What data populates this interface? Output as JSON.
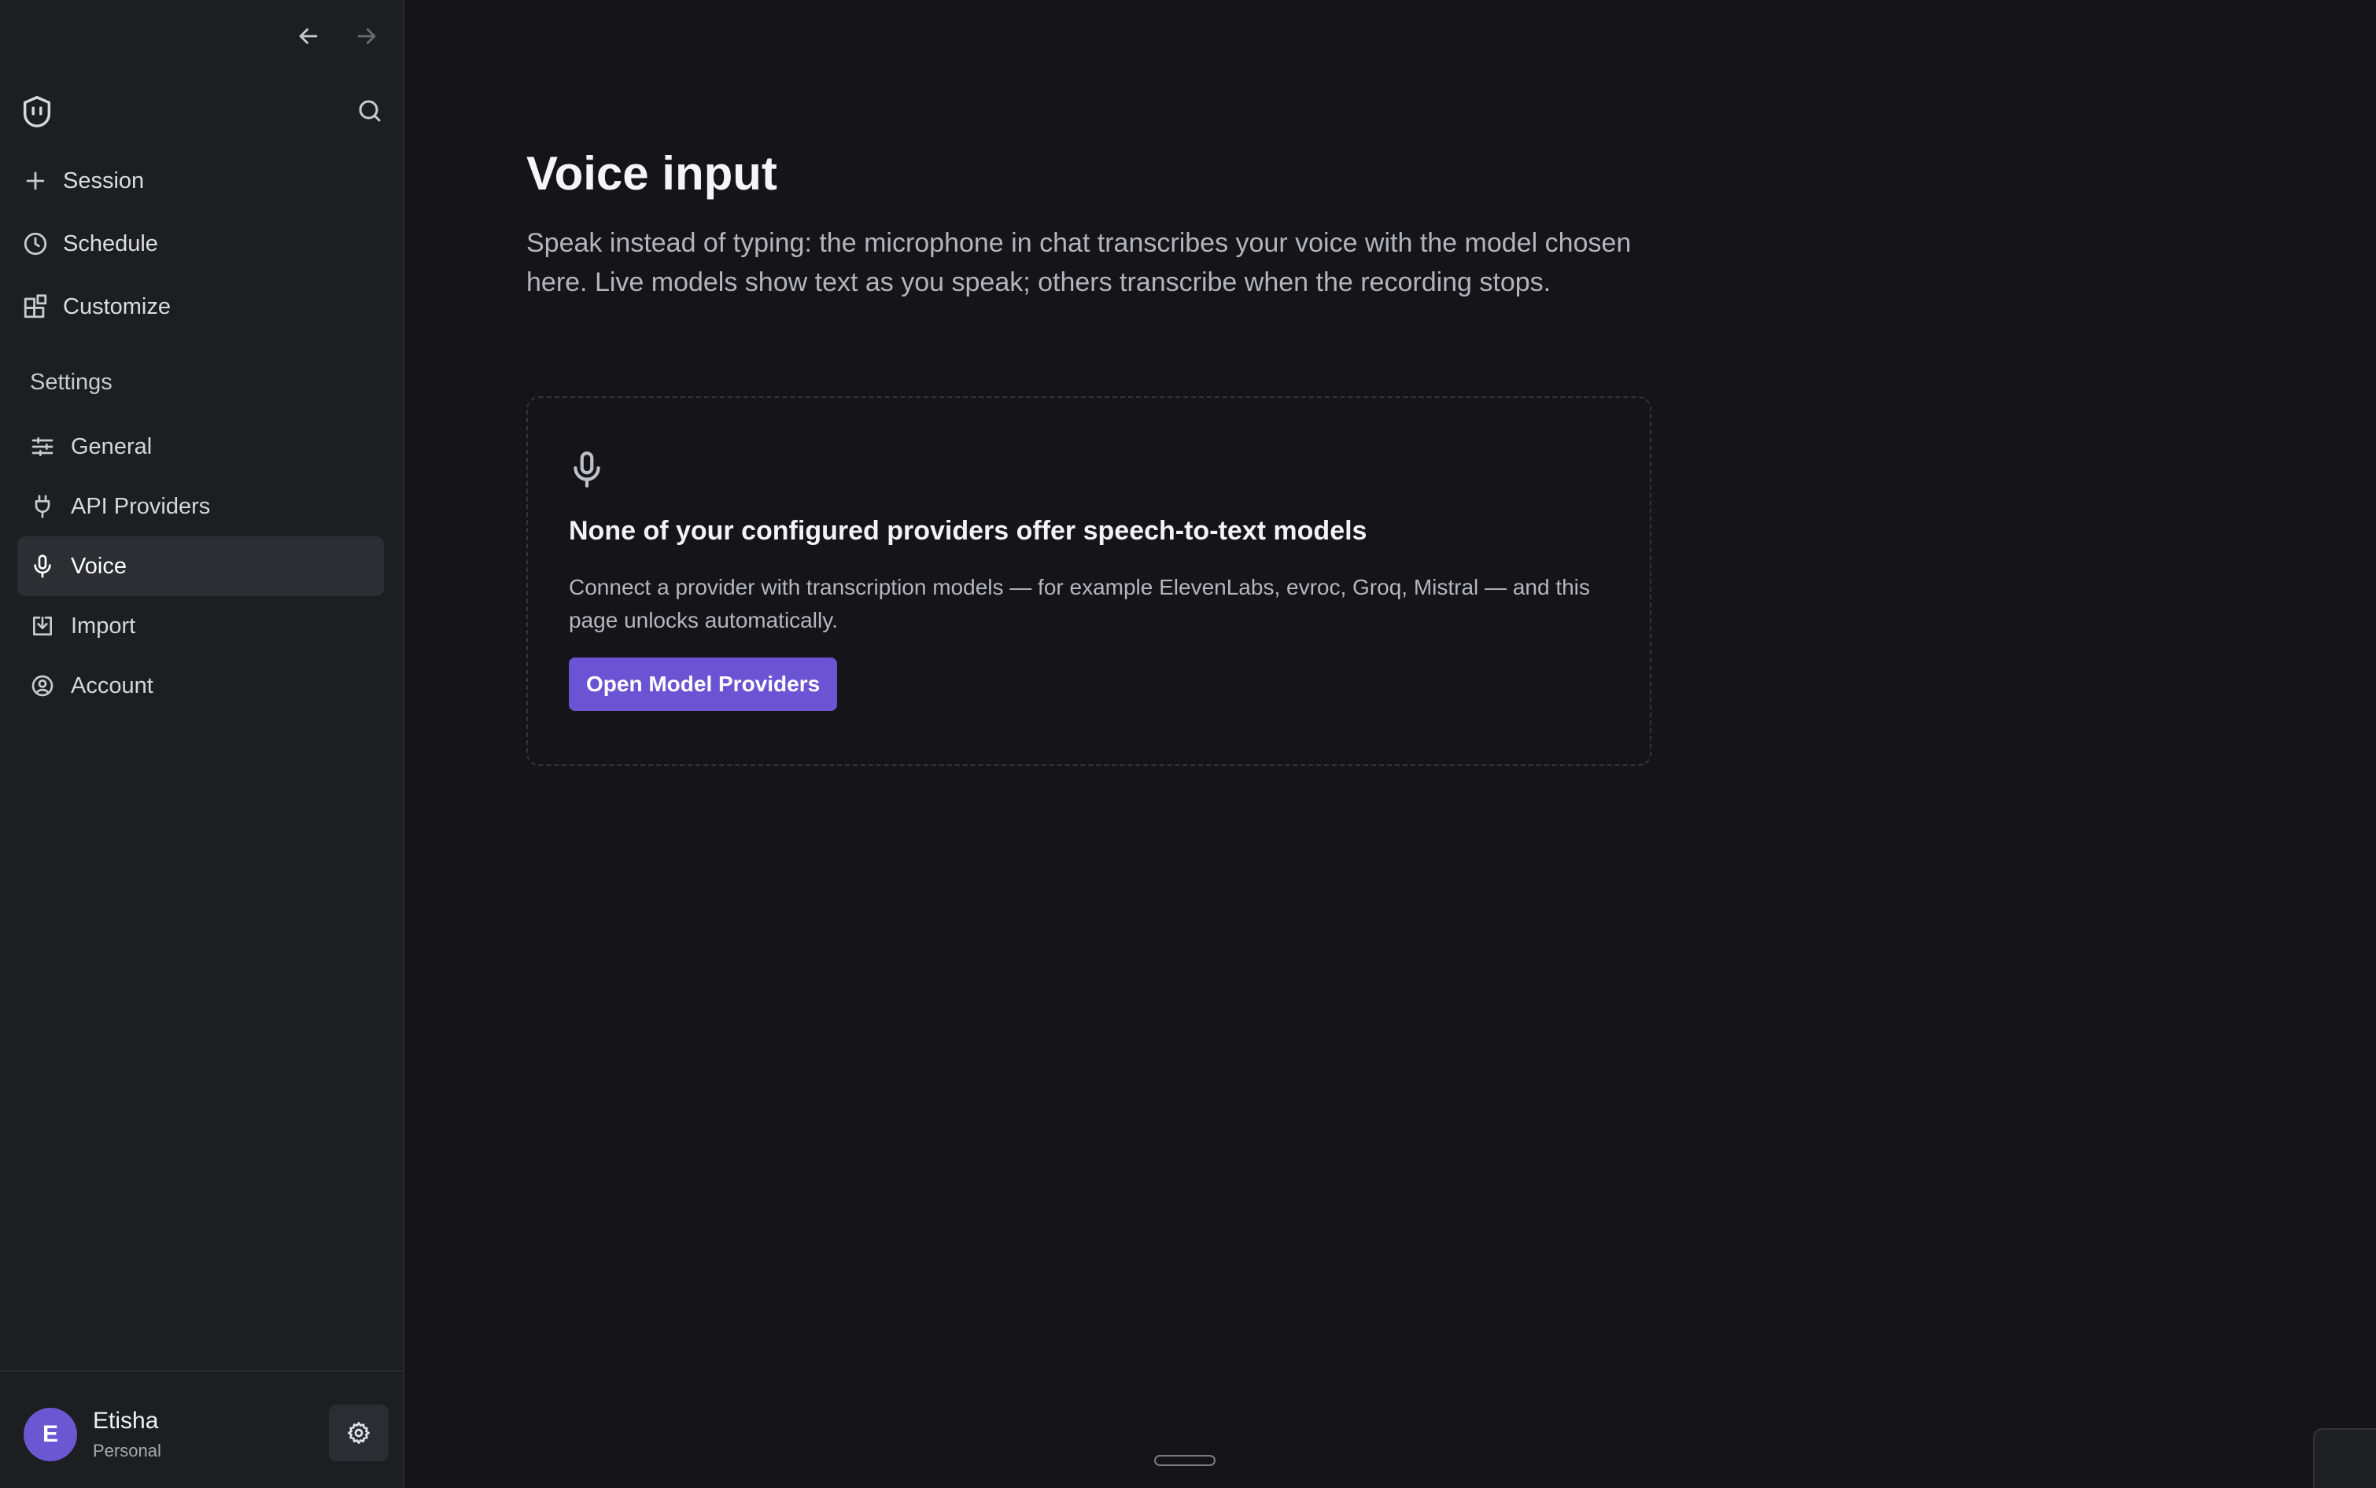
{
  "sidebar": {
    "top_items": [
      {
        "label": "Session",
        "icon": "plus-icon"
      },
      {
        "label": "Schedule",
        "icon": "clock-icon"
      },
      {
        "label": "Customize",
        "icon": "blocks-icon"
      }
    ],
    "settings_header": "Settings",
    "settings_items": [
      {
        "label": "General",
        "icon": "sliders-icon"
      },
      {
        "label": "API Providers",
        "icon": "plug-icon"
      },
      {
        "label": "Voice",
        "icon": "microphone-icon",
        "active": true
      },
      {
        "label": "Import",
        "icon": "import-icon"
      },
      {
        "label": "Account",
        "icon": "user-circle-icon"
      }
    ],
    "user": {
      "initial": "E",
      "name": "Etisha",
      "plan": "Personal"
    }
  },
  "main": {
    "title": "Voice input",
    "description": "Speak instead of typing: the microphone in chat transcribes your voice with the model chosen here. Live models show text as you speak; others transcribe when the recording stops.",
    "empty_state": {
      "icon": "microphone-icon",
      "title": "None of your configured providers offer speech-to-text models",
      "description": "Connect a provider with transcription models — for example ElevenLabs, evroc, Groq, Mistral — and this page unlocks automatically.",
      "button_label": "Open Model Providers"
    }
  },
  "colors": {
    "background": "#141419",
    "sidebar": "#1d1e21",
    "accent": "#6a54d4",
    "active_item": "#2d2e33"
  }
}
